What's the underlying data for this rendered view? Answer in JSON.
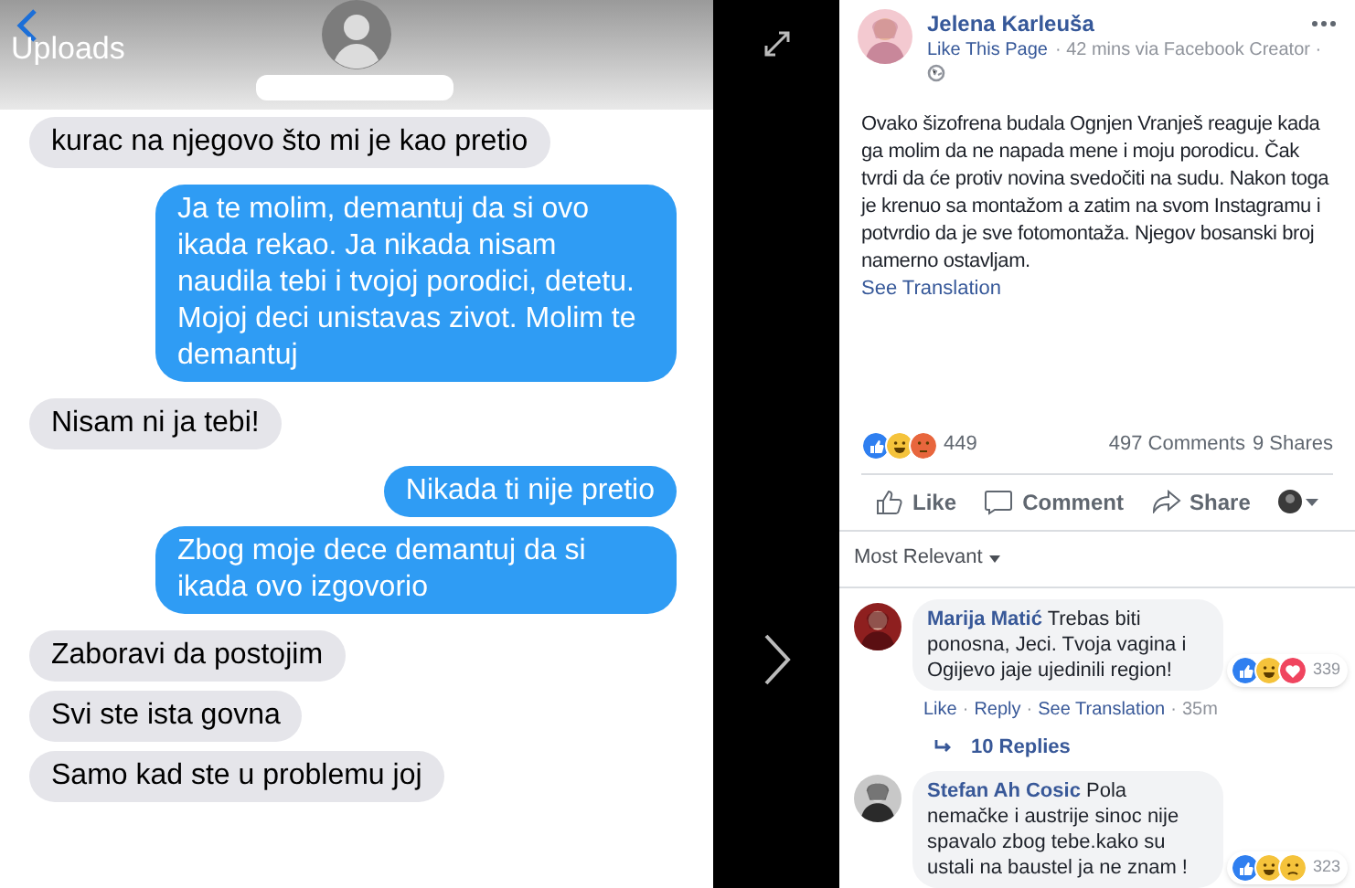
{
  "photo": {
    "back_label": "Uploads",
    "messages": [
      {
        "kind": "received",
        "text": "kurac na njegovo što mi je kao pretio"
      },
      {
        "kind": "sent",
        "text": "Ja te molim, demantuj da si ovo ikada rekao. Ja nikada nisam naudila tebi i tvojoj porodici, detetu. Mojoj deci unistavas zivot. Molim te demantuj"
      },
      {
        "kind": "received",
        "text": "Nisam ni ja tebi!"
      },
      {
        "kind": "sent",
        "text": "Nikada ti nije pretio"
      },
      {
        "kind": "sent",
        "text": "Zbog moje dece demantuj da si ikada ovo izgovorio"
      },
      {
        "kind": "received",
        "text": "Zaboravi da postojim"
      },
      {
        "kind": "received",
        "text": "Svi ste ista govna"
      },
      {
        "kind": "received",
        "text": "Samo kad ste u problemu joj"
      }
    ]
  },
  "post": {
    "author": "Jelena Karleuša",
    "like_page": "Like This Page",
    "meta": "· 42 mins via Facebook Creator ·",
    "text": "Ovako šizofrena budala Ognjen Vranješ reaguje kada ga molim da ne napada mene i moju porodicu. Čak tvrdi da će protiv novina svedočiti na sudu. Nakon toga je krenuo sa montažom a zatim na svom Instagramu i potvrdio da je sve fotomontaža. Njegov bosanski broj namerno ostavljam.",
    "see_translation": "See Translation",
    "reactions": [
      {
        "kind": "like"
      },
      {
        "kind": "haha"
      },
      {
        "kind": "angry"
      }
    ],
    "reaction_count": "449",
    "comments": "497 Comments",
    "shares": "9 Shares",
    "actions": [
      {
        "kind": "like",
        "label": "Like"
      },
      {
        "kind": "comment",
        "label": "Comment"
      },
      {
        "kind": "share",
        "label": "Share"
      }
    ],
    "sort": "Most Relevant"
  },
  "comments": [
    {
      "author": "Marija Matić",
      "text": "Trebas biti ponosna, Jeci. Tvoja vagina i Ogijevo jaje ujedinili region!",
      "reactions": [
        {
          "kind": "like"
        },
        {
          "kind": "haha"
        },
        {
          "kind": "love"
        }
      ],
      "reaction_count": "339",
      "links": [
        "Like",
        "Reply",
        "See Translation"
      ],
      "separator": "·",
      "time": "35m",
      "replies": "10 Replies"
    },
    {
      "author": "Stefan Ah Cosic",
      "text": "Pola nemačke i austrije sinoc nije spavalo zbog tebe.kako su ustali na baustel ja ne znam !",
      "reactions": [
        {
          "kind": "like"
        },
        {
          "kind": "haha"
        },
        {
          "kind": "sad"
        }
      ],
      "reaction_count": "323"
    }
  ]
}
